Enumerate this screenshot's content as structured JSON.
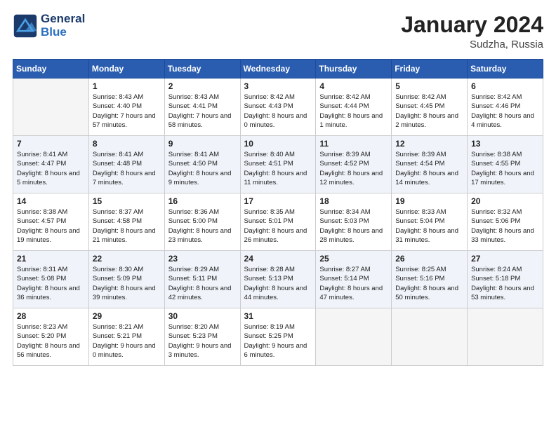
{
  "logo": {
    "line1": "General",
    "line2": "Blue"
  },
  "title": "January 2024",
  "subtitle": "Sudzha, Russia",
  "days_of_week": [
    "Sunday",
    "Monday",
    "Tuesday",
    "Wednesday",
    "Thursday",
    "Friday",
    "Saturday"
  ],
  "weeks": [
    [
      {
        "day": "",
        "empty": true
      },
      {
        "day": "1",
        "sunrise": "Sunrise: 8:43 AM",
        "sunset": "Sunset: 4:40 PM",
        "daylight": "Daylight: 7 hours and 57 minutes."
      },
      {
        "day": "2",
        "sunrise": "Sunrise: 8:43 AM",
        "sunset": "Sunset: 4:41 PM",
        "daylight": "Daylight: 7 hours and 58 minutes."
      },
      {
        "day": "3",
        "sunrise": "Sunrise: 8:42 AM",
        "sunset": "Sunset: 4:43 PM",
        "daylight": "Daylight: 8 hours and 0 minutes."
      },
      {
        "day": "4",
        "sunrise": "Sunrise: 8:42 AM",
        "sunset": "Sunset: 4:44 PM",
        "daylight": "Daylight: 8 hours and 1 minute."
      },
      {
        "day": "5",
        "sunrise": "Sunrise: 8:42 AM",
        "sunset": "Sunset: 4:45 PM",
        "daylight": "Daylight: 8 hours and 2 minutes."
      },
      {
        "day": "6",
        "sunrise": "Sunrise: 8:42 AM",
        "sunset": "Sunset: 4:46 PM",
        "daylight": "Daylight: 8 hours and 4 minutes."
      }
    ],
    [
      {
        "day": "7",
        "sunrise": "Sunrise: 8:41 AM",
        "sunset": "Sunset: 4:47 PM",
        "daylight": "Daylight: 8 hours and 5 minutes."
      },
      {
        "day": "8",
        "sunrise": "Sunrise: 8:41 AM",
        "sunset": "Sunset: 4:48 PM",
        "daylight": "Daylight: 8 hours and 7 minutes."
      },
      {
        "day": "9",
        "sunrise": "Sunrise: 8:41 AM",
        "sunset": "Sunset: 4:50 PM",
        "daylight": "Daylight: 8 hours and 9 minutes."
      },
      {
        "day": "10",
        "sunrise": "Sunrise: 8:40 AM",
        "sunset": "Sunset: 4:51 PM",
        "daylight": "Daylight: 8 hours and 11 minutes."
      },
      {
        "day": "11",
        "sunrise": "Sunrise: 8:39 AM",
        "sunset": "Sunset: 4:52 PM",
        "daylight": "Daylight: 8 hours and 12 minutes."
      },
      {
        "day": "12",
        "sunrise": "Sunrise: 8:39 AM",
        "sunset": "Sunset: 4:54 PM",
        "daylight": "Daylight: 8 hours and 14 minutes."
      },
      {
        "day": "13",
        "sunrise": "Sunrise: 8:38 AM",
        "sunset": "Sunset: 4:55 PM",
        "daylight": "Daylight: 8 hours and 17 minutes."
      }
    ],
    [
      {
        "day": "14",
        "sunrise": "Sunrise: 8:38 AM",
        "sunset": "Sunset: 4:57 PM",
        "daylight": "Daylight: 8 hours and 19 minutes."
      },
      {
        "day": "15",
        "sunrise": "Sunrise: 8:37 AM",
        "sunset": "Sunset: 4:58 PM",
        "daylight": "Daylight: 8 hours and 21 minutes."
      },
      {
        "day": "16",
        "sunrise": "Sunrise: 8:36 AM",
        "sunset": "Sunset: 5:00 PM",
        "daylight": "Daylight: 8 hours and 23 minutes."
      },
      {
        "day": "17",
        "sunrise": "Sunrise: 8:35 AM",
        "sunset": "Sunset: 5:01 PM",
        "daylight": "Daylight: 8 hours and 26 minutes."
      },
      {
        "day": "18",
        "sunrise": "Sunrise: 8:34 AM",
        "sunset": "Sunset: 5:03 PM",
        "daylight": "Daylight: 8 hours and 28 minutes."
      },
      {
        "day": "19",
        "sunrise": "Sunrise: 8:33 AM",
        "sunset": "Sunset: 5:04 PM",
        "daylight": "Daylight: 8 hours and 31 minutes."
      },
      {
        "day": "20",
        "sunrise": "Sunrise: 8:32 AM",
        "sunset": "Sunset: 5:06 PM",
        "daylight": "Daylight: 8 hours and 33 minutes."
      }
    ],
    [
      {
        "day": "21",
        "sunrise": "Sunrise: 8:31 AM",
        "sunset": "Sunset: 5:08 PM",
        "daylight": "Daylight: 8 hours and 36 minutes."
      },
      {
        "day": "22",
        "sunrise": "Sunrise: 8:30 AM",
        "sunset": "Sunset: 5:09 PM",
        "daylight": "Daylight: 8 hours and 39 minutes."
      },
      {
        "day": "23",
        "sunrise": "Sunrise: 8:29 AM",
        "sunset": "Sunset: 5:11 PM",
        "daylight": "Daylight: 8 hours and 42 minutes."
      },
      {
        "day": "24",
        "sunrise": "Sunrise: 8:28 AM",
        "sunset": "Sunset: 5:13 PM",
        "daylight": "Daylight: 8 hours and 44 minutes."
      },
      {
        "day": "25",
        "sunrise": "Sunrise: 8:27 AM",
        "sunset": "Sunset: 5:14 PM",
        "daylight": "Daylight: 8 hours and 47 minutes."
      },
      {
        "day": "26",
        "sunrise": "Sunrise: 8:25 AM",
        "sunset": "Sunset: 5:16 PM",
        "daylight": "Daylight: 8 hours and 50 minutes."
      },
      {
        "day": "27",
        "sunrise": "Sunrise: 8:24 AM",
        "sunset": "Sunset: 5:18 PM",
        "daylight": "Daylight: 8 hours and 53 minutes."
      }
    ],
    [
      {
        "day": "28",
        "sunrise": "Sunrise: 8:23 AM",
        "sunset": "Sunset: 5:20 PM",
        "daylight": "Daylight: 8 hours and 56 minutes."
      },
      {
        "day": "29",
        "sunrise": "Sunrise: 8:21 AM",
        "sunset": "Sunset: 5:21 PM",
        "daylight": "Daylight: 9 hours and 0 minutes."
      },
      {
        "day": "30",
        "sunrise": "Sunrise: 8:20 AM",
        "sunset": "Sunset: 5:23 PM",
        "daylight": "Daylight: 9 hours and 3 minutes."
      },
      {
        "day": "31",
        "sunrise": "Sunrise: 8:19 AM",
        "sunset": "Sunset: 5:25 PM",
        "daylight": "Daylight: 9 hours and 6 minutes."
      },
      {
        "day": "",
        "empty": true
      },
      {
        "day": "",
        "empty": true
      },
      {
        "day": "",
        "empty": true
      }
    ]
  ]
}
